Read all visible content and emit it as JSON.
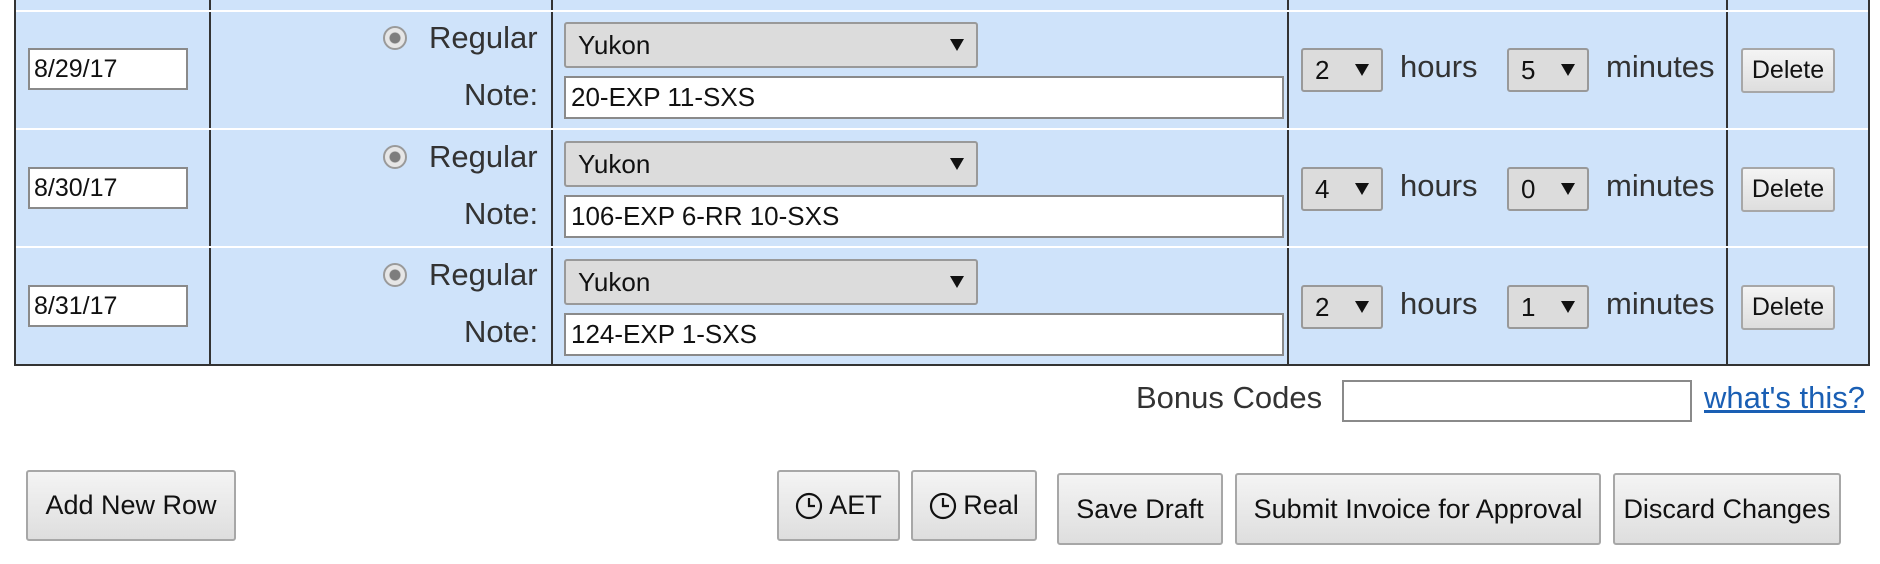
{
  "rows": [
    {
      "date": "8/29/17",
      "type_label": "Regular",
      "note_label": "Note:",
      "project": "Yukon",
      "note": "20-EXP 11-SXS",
      "hours": "2",
      "hours_label": "hours",
      "minutes": "5",
      "minutes_label": "minutes",
      "delete_label": "Delete"
    },
    {
      "date": "8/30/17",
      "type_label": "Regular",
      "note_label": "Note:",
      "project": "Yukon",
      "note": "106-EXP 6-RR 10-SXS",
      "hours": "4",
      "hours_label": "hours",
      "minutes": "0",
      "minutes_label": "minutes",
      "delete_label": "Delete"
    },
    {
      "date": "8/31/17",
      "type_label": "Regular",
      "note_label": "Note:",
      "project": "Yukon",
      "note": "124-EXP 1-SXS",
      "hours": "2",
      "hours_label": "hours",
      "minutes": "1",
      "minutes_label": "minutes",
      "delete_label": "Delete"
    }
  ],
  "bonus": {
    "label": "Bonus Codes",
    "value": "",
    "help_link": "what's this?"
  },
  "footer": {
    "add_row": "Add New Row",
    "aet": "AET",
    "real": "Real",
    "save_draft": "Save Draft",
    "submit": "Submit Invoice for Approval",
    "discard": "Discard Changes"
  },
  "icons": {
    "clock": "clock-icon",
    "dropdown": "chevron-down-icon",
    "radio": "radio-selected"
  }
}
